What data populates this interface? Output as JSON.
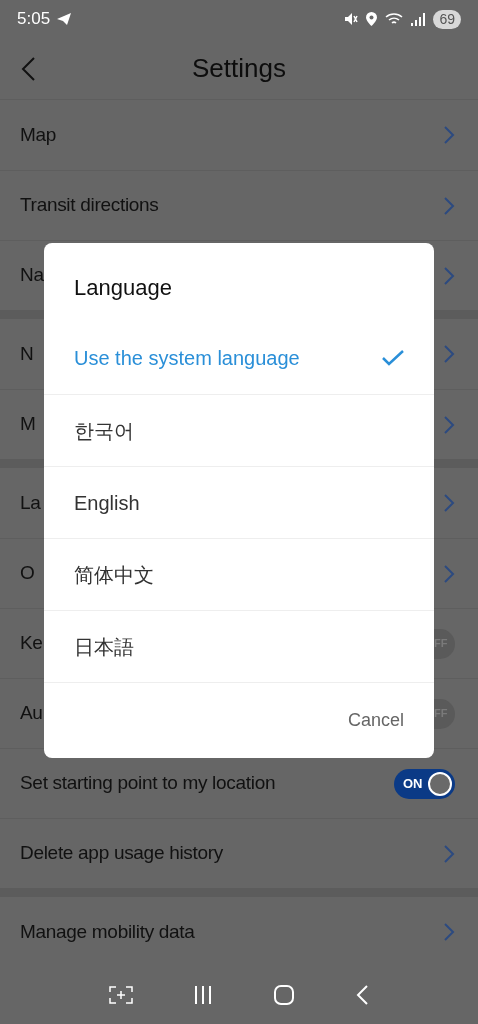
{
  "status_bar": {
    "time": "5:05",
    "battery": "69"
  },
  "header": {
    "title": "Settings"
  },
  "settings": [
    {
      "rows": [
        {
          "label": "Map",
          "kind": "link"
        },
        {
          "label": "Transit directions",
          "kind": "link"
        },
        {
          "label": "Na",
          "kind": "link"
        }
      ]
    },
    {
      "rows": [
        {
          "label": "N",
          "kind": "link"
        },
        {
          "label": "M",
          "kind": "link"
        }
      ]
    },
    {
      "rows": [
        {
          "label": "La",
          "kind": "link"
        },
        {
          "label": "O",
          "kind": "link"
        },
        {
          "label": "Ke",
          "kind": "toggle",
          "on": false,
          "toggle_text": "FF"
        },
        {
          "label": "Au",
          "kind": "toggle",
          "on": false,
          "toggle_text": "FF"
        },
        {
          "label": "Set starting point to my location",
          "kind": "toggle",
          "on": true,
          "toggle_text": "ON"
        },
        {
          "label": "Delete app usage history",
          "kind": "link"
        }
      ]
    },
    {
      "rows": [
        {
          "label": "Manage mobility data",
          "kind": "link"
        }
      ]
    }
  ],
  "dialog": {
    "title": "Language",
    "options": [
      {
        "label": "Use the system language",
        "selected": true
      },
      {
        "label": "한국어",
        "selected": false
      },
      {
        "label": "English",
        "selected": false
      },
      {
        "label": "简体中文",
        "selected": false
      },
      {
        "label": "日本語",
        "selected": false
      }
    ],
    "cancel": "Cancel"
  }
}
